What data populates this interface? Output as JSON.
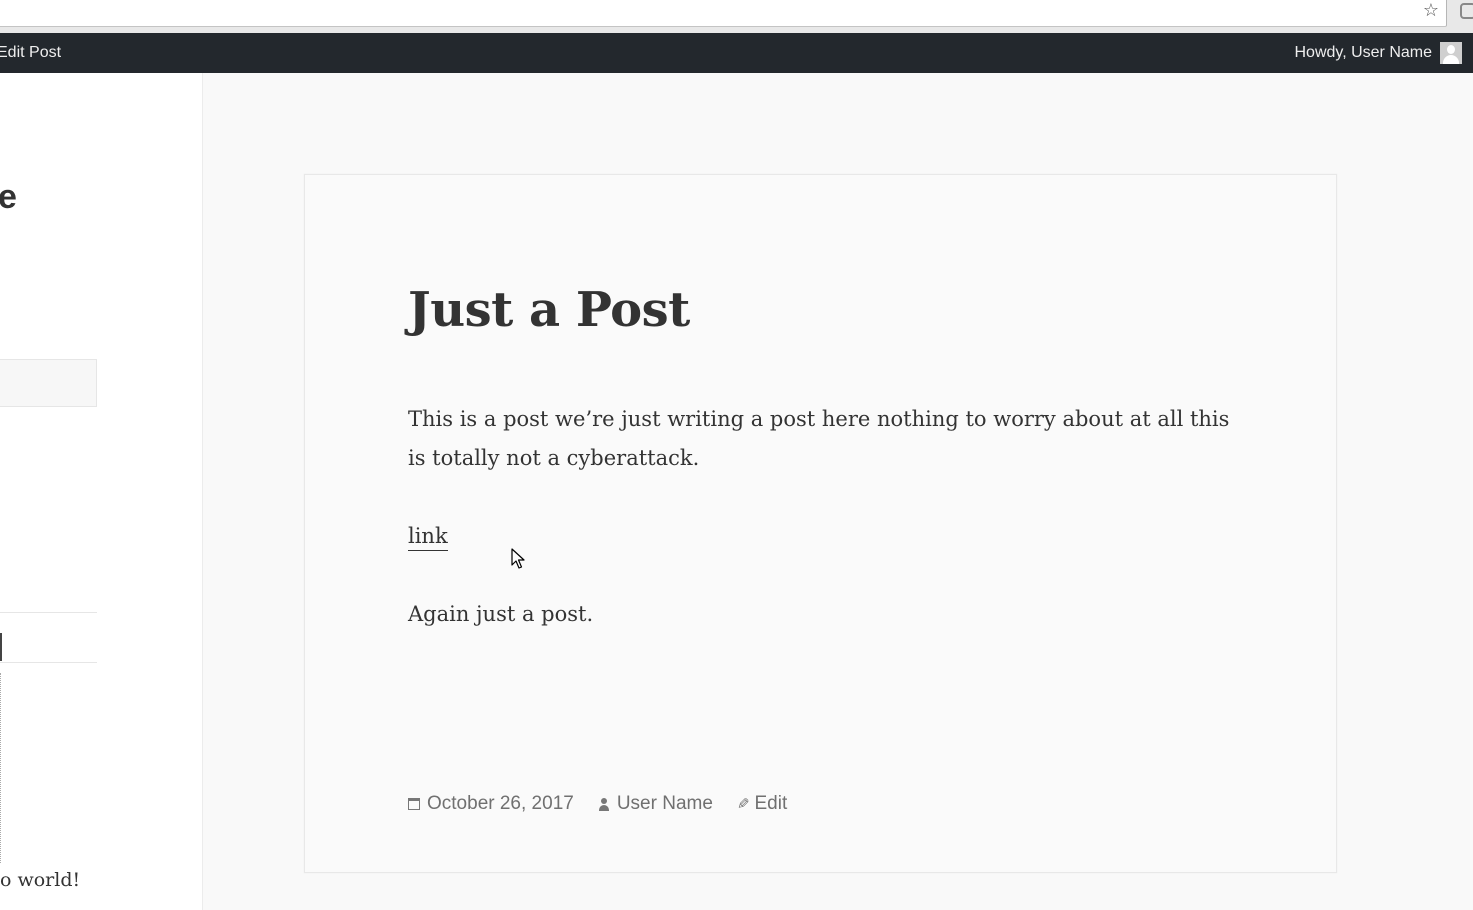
{
  "browser": {
    "star_glyph": "☆"
  },
  "admin_bar": {
    "edit_post_label": "Edit Post",
    "howdy_label": "Howdy, User Name"
  },
  "sidebar": {
    "site_title_fragment": "e",
    "recent_post_fragment": "o world!"
  },
  "post": {
    "title": "Just a Post",
    "paragraphs": [
      "This is a post we’re just writing a post here nothing to worry about at all this is totally not a cyberattack.",
      "Again just a post."
    ],
    "link_label": "link",
    "footer": {
      "date": "October 26, 2017",
      "author": "User Name",
      "edit_label": "Edit"
    }
  },
  "colors": {
    "admin_bar_bg": "#23282d",
    "page_bg": "#f9f9f9",
    "text": "#333333",
    "meta_text": "#707070"
  }
}
